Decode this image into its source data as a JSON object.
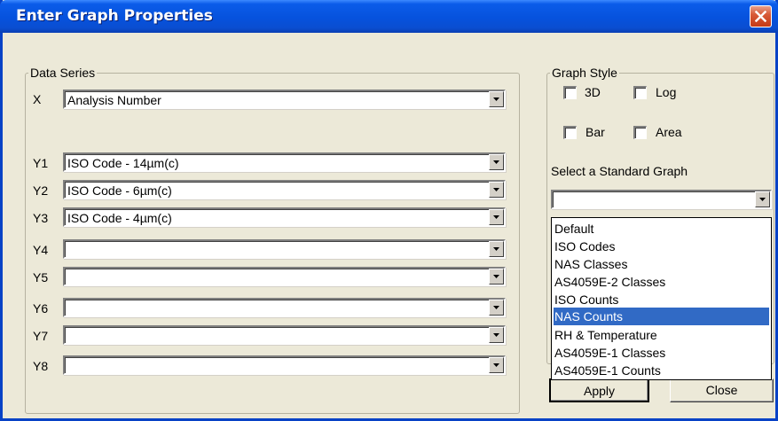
{
  "window": {
    "title": "Enter Graph Properties"
  },
  "data_series": {
    "legend": "Data Series",
    "rows": [
      {
        "label": "X",
        "value": "Analysis Number"
      },
      {
        "label": "Y1",
        "value": "ISO Code - 14µm(c)"
      },
      {
        "label": "Y2",
        "value": "ISO Code - 6µm(c)"
      },
      {
        "label": "Y3",
        "value": "ISO Code - 4µm(c)"
      },
      {
        "label": "Y4",
        "value": ""
      },
      {
        "label": "Y5",
        "value": ""
      },
      {
        "label": "Y6",
        "value": ""
      },
      {
        "label": "Y7",
        "value": ""
      },
      {
        "label": "Y8",
        "value": ""
      }
    ]
  },
  "graph_style": {
    "legend": "Graph Style",
    "checkboxes": [
      {
        "label": "3D",
        "checked": false
      },
      {
        "label": "Log",
        "checked": false
      },
      {
        "label": "Bar",
        "checked": false
      },
      {
        "label": "Area",
        "checked": false
      }
    ],
    "standard_graph_label": "Select a Standard Graph",
    "standard_graph_value": "",
    "options": [
      "Default",
      "ISO Codes",
      "NAS Classes",
      "AS4059E-2 Classes",
      "ISO Counts",
      "NAS Counts",
      "RH & Temperature",
      "AS4059E-1 Classes",
      "AS4059E-1 Counts"
    ],
    "selected_option": "NAS Counts"
  },
  "buttons": {
    "apply": "Apply",
    "close": "Close"
  },
  "icons": {
    "close": "close-x-icon",
    "dropdown": "dropdown-arrow-icon"
  },
  "colors": {
    "titlebar": "#0a5ce8",
    "selection": "#316ac5",
    "dialog_bg": "#ece9d8"
  }
}
